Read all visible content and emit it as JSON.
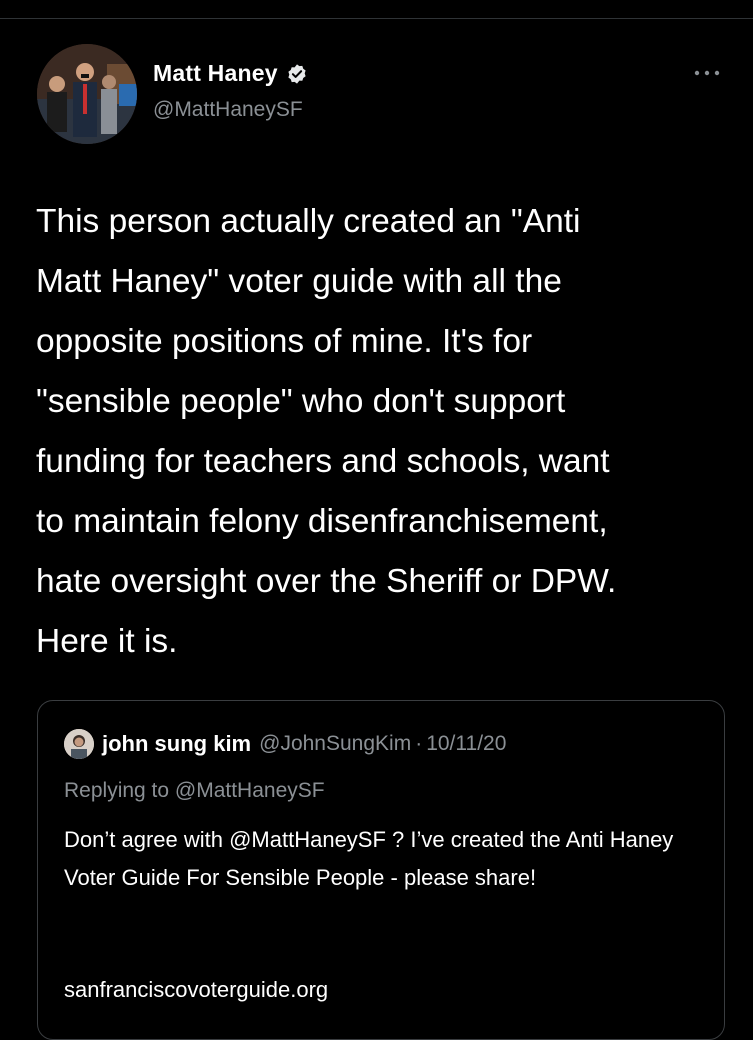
{
  "tweet": {
    "author": {
      "name": "Matt Haney",
      "handle": "@MattHaneySF",
      "verified": true,
      "avatar_icon": "profile-photo-icon"
    },
    "more_icon": "more-options-icon",
    "text": "This person actually created an \"Anti\nMatt Haney\" voter guide with all the\nopposite positions of mine.  It's for\n\"sensible people\" who don't support\nfunding for teachers and schools, want\nto maintain felony disenfranchisement,\nhate oversight over the Sheriff or DPW.\nHere it is.",
    "quoted_tweet": {
      "author_name": "john sung kim",
      "author_handle": "@JohnSungKim",
      "separator": "·",
      "date": "10/11/20",
      "reply_context": "Replying to @MattHaneySF",
      "body": "Don’t agree with @MattHaneySF ? I’ve created the Anti Haney Voter Guide For Sensible People - please share!",
      "link": "sanfranciscovoterguide.org"
    }
  },
  "colors": {
    "background": "#000000",
    "primary_text": "#ffffff",
    "secondary_text": "#8b9095",
    "border": "#3a3d40",
    "verified_badge": "#e7e9ea"
  }
}
